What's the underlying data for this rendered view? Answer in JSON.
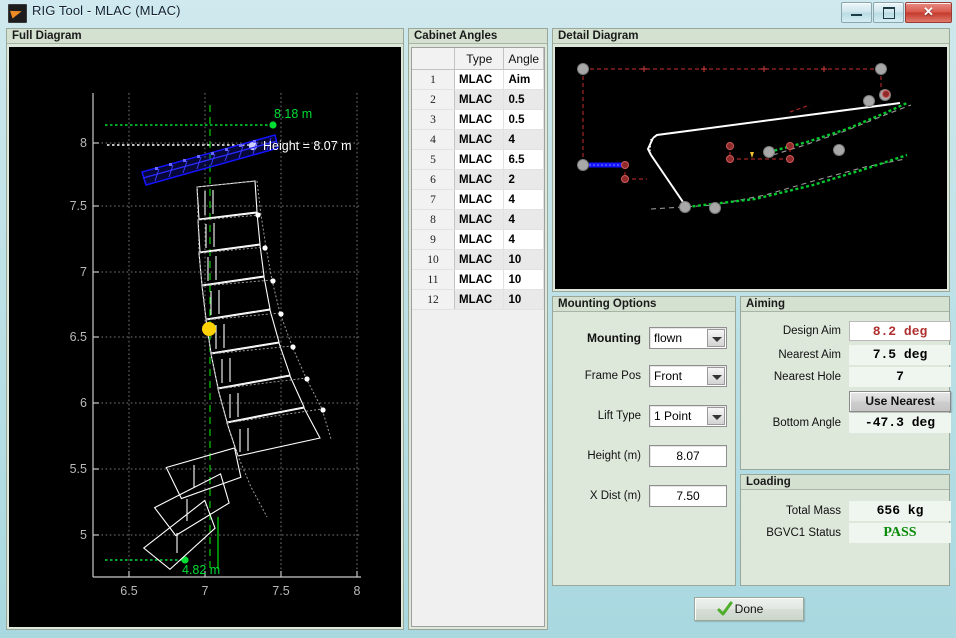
{
  "window": {
    "title": "RIG Tool - MLAC (MLAC)",
    "icon": "matlab-icon",
    "controls": {
      "minimize": "minimize-icon",
      "maximize": "maximize-icon",
      "close": "close-icon"
    }
  },
  "panels": {
    "full_diagram": {
      "title": "Full Diagram"
    },
    "cabinet_angles": {
      "title": "Cabinet Angles"
    },
    "detail_diagram": {
      "title": "Detail Diagram"
    },
    "mounting_options": {
      "title": "Mounting Options"
    },
    "aiming": {
      "title": "Aiming"
    },
    "loading": {
      "title": "Loading"
    }
  },
  "cabinet_table": {
    "columns": [
      "",
      "Type",
      "Angle"
    ],
    "rows": [
      {
        "index": "1",
        "type": "MLAC",
        "angle": "Aim"
      },
      {
        "index": "2",
        "type": "MLAC",
        "angle": "0.5"
      },
      {
        "index": "3",
        "type": "MLAC",
        "angle": "0.5"
      },
      {
        "index": "4",
        "type": "MLAC",
        "angle": "4"
      },
      {
        "index": "5",
        "type": "MLAC",
        "angle": "6.5"
      },
      {
        "index": "6",
        "type": "MLAC",
        "angle": "2"
      },
      {
        "index": "7",
        "type": "MLAC",
        "angle": "4"
      },
      {
        "index": "8",
        "type": "MLAC",
        "angle": "4"
      },
      {
        "index": "9",
        "type": "MLAC",
        "angle": "4"
      },
      {
        "index": "10",
        "type": "MLAC",
        "angle": "10"
      },
      {
        "index": "11",
        "type": "MLAC",
        "angle": "10"
      },
      {
        "index": "12",
        "type": "MLAC",
        "angle": "10"
      }
    ]
  },
  "mounting": {
    "mounting_label": "Mounting",
    "mounting_value": "flown",
    "frame_pos_label": "Frame Pos",
    "frame_pos_value": "Front",
    "lift_type_label": "Lift Type",
    "lift_type_value": "1 Point",
    "height_label": "Height (m)",
    "height_value": "8.07",
    "xdist_label": "X Dist (m)",
    "xdist_value": "7.50"
  },
  "aiming": {
    "design_aim_label": "Design Aim",
    "design_aim_value": "8.2 deg",
    "nearest_aim_label": "Nearest Aim",
    "nearest_aim_value": "7.5 deg",
    "nearest_hole_label": "Nearest Hole",
    "nearest_hole_value": "7",
    "use_nearest_button": "Use Nearest",
    "bottom_angle_label": "Bottom Angle",
    "bottom_angle_value": "-47.3 deg"
  },
  "loading": {
    "total_mass_label": "Total Mass",
    "total_mass_value": "656 kg",
    "bgvc1_label": "BGVC1 Status",
    "bgvc1_value": "PASS"
  },
  "footer": {
    "done_label": "Done",
    "done_icon": "check-icon"
  },
  "chart_data": {
    "type": "scatter",
    "title": "Full Diagram",
    "xlabel": "",
    "ylabel": "",
    "xlim": [
      6.25,
      8.2
    ],
    "ylim": [
      4.72,
      8.3
    ],
    "xticks": [
      "6.5",
      "7",
      "7.5",
      "8"
    ],
    "yticks": [
      "5",
      "5.5",
      "6",
      "6.5",
      "7",
      "7.5",
      "8"
    ],
    "grid": true,
    "annotations": [
      {
        "text": "8.18 m",
        "color": "#00d000",
        "x": 7.72,
        "y": 8.18
      },
      {
        "text": "Height = 8.07 m",
        "color": "#ffffff",
        "x": 7.45,
        "y": 8.07
      },
      {
        "text": "4.82 m",
        "color": "#00d000",
        "x": 7.0,
        "y": 4.82
      }
    ],
    "series": [
      {
        "name": "truss",
        "color": "#1414ff"
      },
      {
        "name": "cabinet-array",
        "color": "#ffffff"
      },
      {
        "name": "aim-marker",
        "color": "#ffe000"
      },
      {
        "name": "top-reference",
        "color": "#00d000"
      },
      {
        "name": "bottom-reference",
        "color": "#00d000"
      }
    ]
  },
  "detail_chart": {
    "type": "scatter",
    "title": "Detail Diagram",
    "grid": false,
    "series": [
      {
        "name": "frame-outline",
        "color": "#ffffff"
      },
      {
        "name": "dimension-lines",
        "color": "#aa2222"
      },
      {
        "name": "chain-path",
        "color": "#00cc33"
      },
      {
        "name": "bumper",
        "color": "#1414ff"
      },
      {
        "name": "pick-points",
        "color": "#b0b0b0"
      }
    ]
  }
}
